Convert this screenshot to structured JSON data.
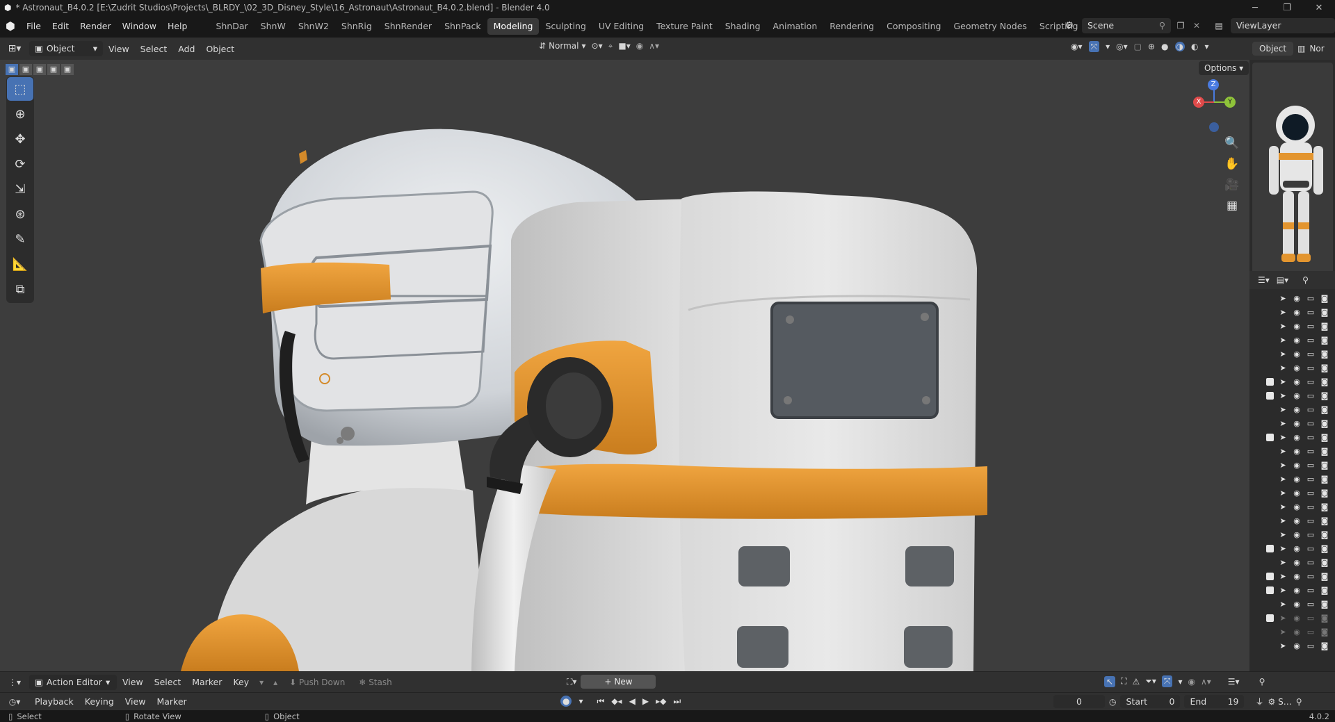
{
  "window": {
    "title": "* Astronaut_B4.0.2 [E:\\Zudrit Studios\\Projects\\_BLRDY_\\02_3D_Disney_Style\\16_Astronaut\\Astronaut_B4.0.2.blend] - Blender 4.0",
    "controls": [
      "─",
      "❐",
      "✕"
    ]
  },
  "menus": [
    "File",
    "Edit",
    "Render",
    "Window",
    "Help"
  ],
  "workspaces": [
    "ShnDar",
    "ShnW",
    "ShnW2",
    "ShnRig",
    "ShnRender",
    "ShnPack",
    "Modeling",
    "Sculpting",
    "UV Editing",
    "Texture Paint",
    "Shading",
    "Animation",
    "Rendering",
    "Compositing",
    "Geometry Nodes",
    "Scripting"
  ],
  "active_workspace": "Modeling",
  "scene": {
    "scene_name": "Scene",
    "view_layer": "ViewLayer"
  },
  "viewport_header": {
    "mode": "Object Mode",
    "menus": [
      "View",
      "Select",
      "Add",
      "Object"
    ],
    "orientation": "Normal",
    "options": "Options"
  },
  "sidebar": {
    "tabs": [
      "Object",
      "Nor"
    ],
    "outliner_rows": [
      {
        "checked": false,
        "dim": false
      },
      {
        "checked": false,
        "dim": false
      },
      {
        "checked": false,
        "dim": false
      },
      {
        "checked": false,
        "dim": false
      },
      {
        "checked": false,
        "dim": false
      },
      {
        "checked": false,
        "dim": false
      },
      {
        "checked": true,
        "dim": false
      },
      {
        "checked": true,
        "dim": false
      },
      {
        "checked": false,
        "dim": false
      },
      {
        "checked": false,
        "dim": false
      },
      {
        "checked": true,
        "dim": false
      },
      {
        "checked": false,
        "dim": false
      },
      {
        "checked": false,
        "dim": false
      },
      {
        "checked": false,
        "dim": false
      },
      {
        "checked": false,
        "dim": false
      },
      {
        "checked": false,
        "dim": false
      },
      {
        "checked": false,
        "dim": false
      },
      {
        "checked": false,
        "dim": false
      },
      {
        "checked": true,
        "dim": false
      },
      {
        "checked": false,
        "dim": false
      },
      {
        "checked": true,
        "dim": false
      },
      {
        "checked": true,
        "dim": false
      },
      {
        "checked": false,
        "dim": false
      },
      {
        "checked": true,
        "dim": true
      },
      {
        "checked": false,
        "dim": true
      },
      {
        "checked": false,
        "dim": false
      }
    ]
  },
  "action_editor": {
    "mode": "Action Editor",
    "menus": [
      "View",
      "Select",
      "Marker",
      "Key"
    ],
    "push_down": "Push Down",
    "stash": "Stash",
    "new": "New"
  },
  "timeline": {
    "menus": [
      "Playback",
      "Keying",
      "View",
      "Marker"
    ],
    "current_frame": "0",
    "start_label": "Start",
    "start": "0",
    "end_label": "End",
    "end": "19"
  },
  "statusbar": {
    "select": "Select",
    "rotate": "Rotate View",
    "object": "Object",
    "version": "4.0.2"
  },
  "gizmo": {
    "x": "X",
    "y": "Y",
    "z": "Z"
  },
  "colors": {
    "accent": "#4772b3",
    "orange": "#e3952f",
    "suit": "#e6e6e6",
    "viewport_bg": "#3d3d3d"
  }
}
